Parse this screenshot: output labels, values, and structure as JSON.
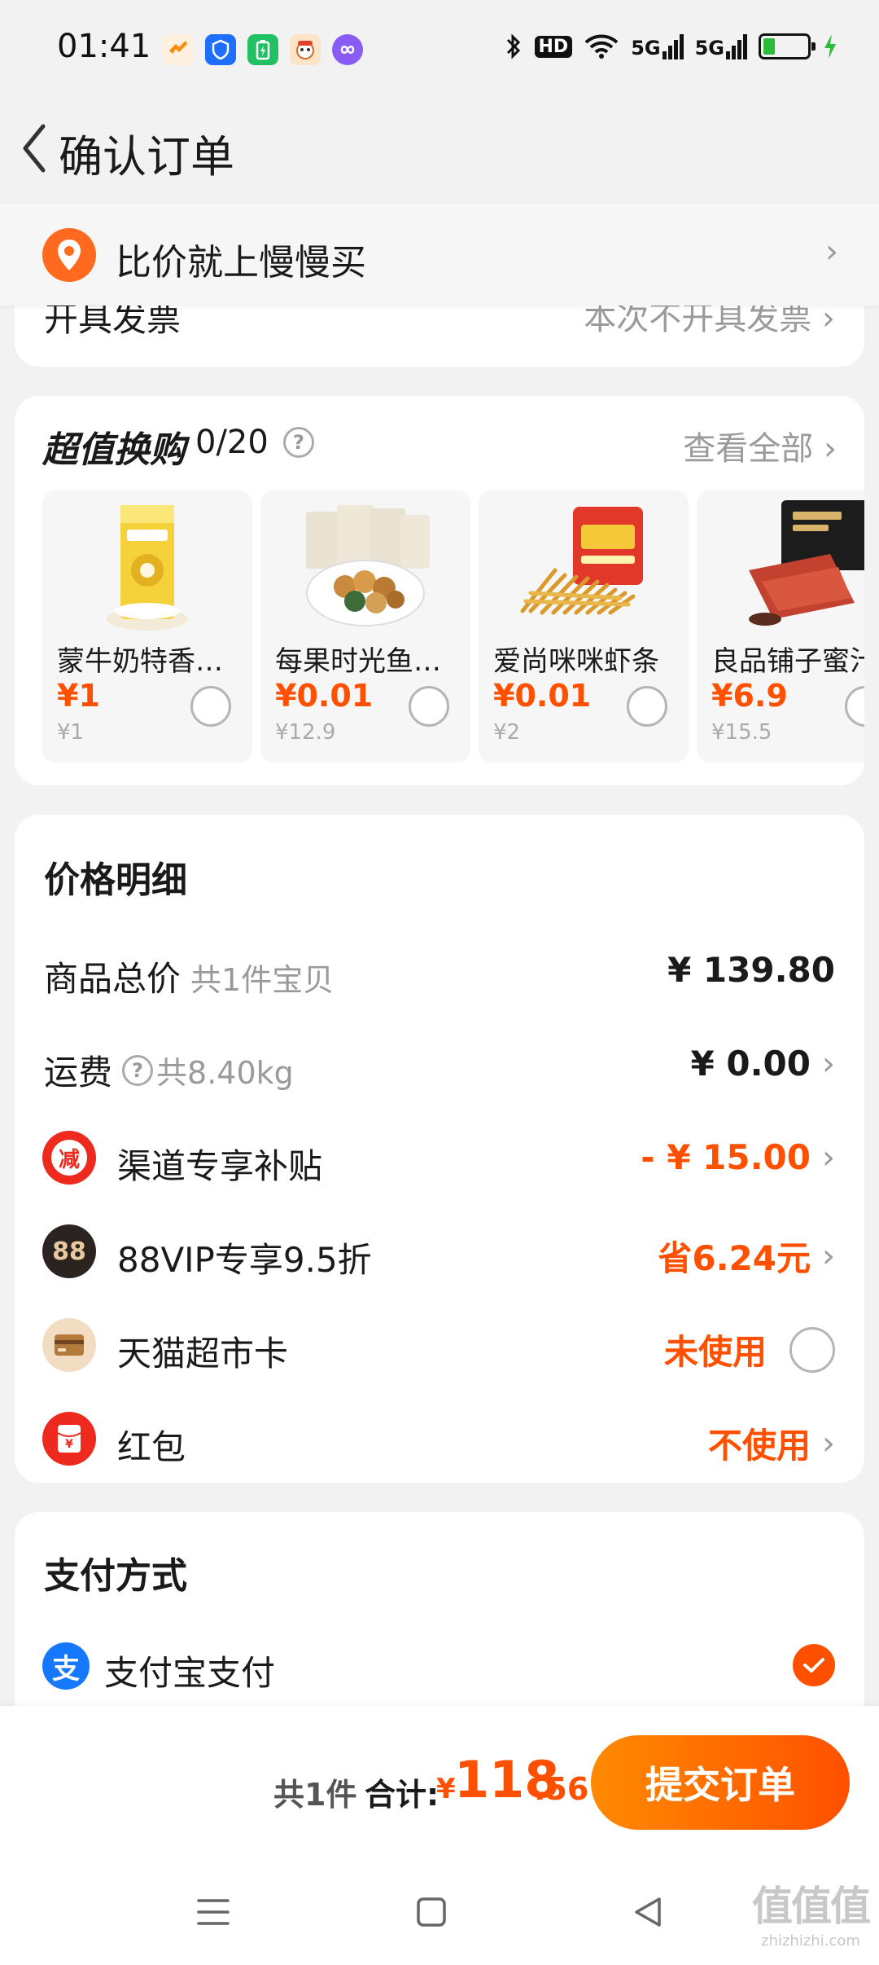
{
  "status_bar": {
    "time": "01:41",
    "hd_label": "HD",
    "signal_labels": [
      "5G",
      "5G"
    ]
  },
  "header": {
    "title": "确认订单"
  },
  "promo": {
    "text": "比价就上慢慢买"
  },
  "invoice": {
    "label": "开具发票",
    "value": "本次不开具发票"
  },
  "exchange": {
    "title": "超值换购",
    "count": "0/20",
    "view_all": "查看全部",
    "items": [
      {
        "name": "蒙牛奶特香蕉牛奶",
        "price": "¥1",
        "original": "¥1"
      },
      {
        "name": "每果时光鱼皮花生",
        "price": "¥0.01",
        "original": "¥12.9"
      },
      {
        "name": "爱尚咪咪虾条",
        "price": "¥0.01",
        "original": "¥2"
      },
      {
        "name": "良品铺子蜜汁",
        "price": "¥6.9",
        "original": "¥15.5"
      }
    ]
  },
  "price_detail": {
    "title": "价格明细",
    "goods_total": {
      "label": "商品总价",
      "sub": "共1件宝贝",
      "value": "¥ 139.80"
    },
    "shipping": {
      "label": "运费",
      "sub": "共8.40kg",
      "value": "¥ 0.00"
    },
    "subsidy": {
      "icon_text": "减",
      "label": "渠道专享补贴",
      "value": "- ¥ 15.00"
    },
    "vip": {
      "icon_text": "88",
      "label": "88VIP专享9.5折",
      "value": "省6.24元"
    },
    "market_card": {
      "label": "天猫超市卡",
      "value": "未使用"
    },
    "red_packet": {
      "icon_text": "¥",
      "label": "红包",
      "value": "不使用"
    }
  },
  "payment": {
    "title": "支付方式",
    "method_icon": "支",
    "method": "支付宝支付"
  },
  "bottom_bar": {
    "count": "共1件",
    "total_label": "合计:",
    "currency": "¥",
    "total_int": "118",
    "total_dec": ".56",
    "submit": "提交订单"
  },
  "watermark": {
    "big": "值值值",
    "small": "zhizhizhi.com"
  },
  "colors": {
    "accent": "#ff5000",
    "alipay": "#1677ff",
    "background": "#f2f2f2"
  }
}
